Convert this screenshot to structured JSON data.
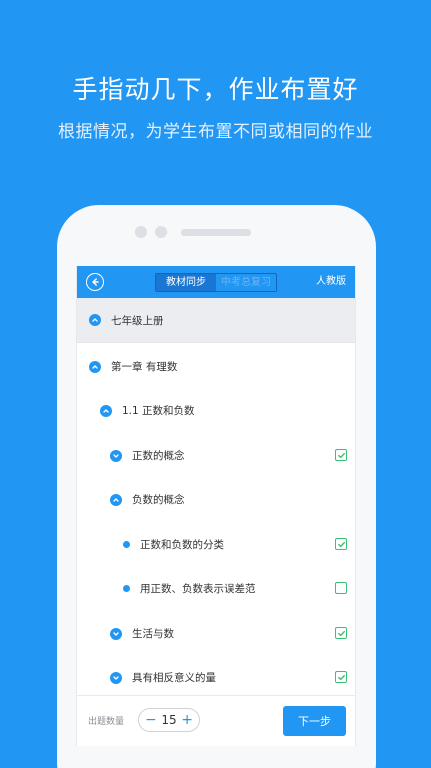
{
  "promo": {
    "title": "手指动几下，作业布置好",
    "subtitle": "根据情况，为学生布置不同或相同的作业"
  },
  "header": {
    "tabs": [
      {
        "label": "教材同步",
        "active": true
      },
      {
        "label": "中考总复习",
        "active": false
      }
    ],
    "edition": "人教版"
  },
  "tree": {
    "grade": "七年级上册",
    "chapter": "第一章 有理数",
    "section": "1.1 正数和负数",
    "items": [
      {
        "label": "正数的概念",
        "type": "node",
        "checked": true
      },
      {
        "label": "负数的概念",
        "type": "node",
        "checked": null
      },
      {
        "label": "正数和负数的分类",
        "type": "leaf",
        "checked": true
      },
      {
        "label": "用正数、负数表示误差范",
        "type": "leaf",
        "checked": false
      },
      {
        "label": "生活与数",
        "type": "node",
        "checked": true
      },
      {
        "label": "具有相反意义的量",
        "type": "node",
        "checked": true
      }
    ]
  },
  "footer": {
    "count_label": "出题数量",
    "minus": "−",
    "count": "15",
    "plus": "+",
    "next_label": "下一步"
  },
  "colors": {
    "primary": "#2196f3",
    "check_green": "#3dbf73"
  }
}
